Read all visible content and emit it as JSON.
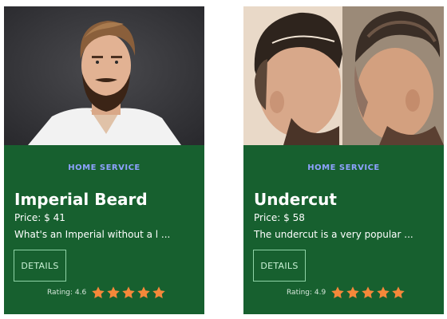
{
  "cards": [
    {
      "tag": "HOME SERVICE",
      "title": "Imperial Beard",
      "price": "Price: $ 41",
      "description": "What's an Imperial without a l ...",
      "details_label": "DETAILS",
      "rating_label": "Rating: 4.6",
      "rating": 4.6,
      "stars_max": 5
    },
    {
      "tag": "HOME SERVICE",
      "title": "Undercut",
      "price": "Price: $ 58",
      "description": "The undercut is a very popular ...",
      "details_label": "DETAILS",
      "rating_label": "Rating: 4.9",
      "rating": 4.9,
      "stars_max": 5
    }
  ],
  "colors": {
    "card_background": "#17602f",
    "tag": "#8ea2ff",
    "star": "#f5883a",
    "button_border": "#8fd3a6"
  },
  "icons": [
    "star-icon"
  ]
}
